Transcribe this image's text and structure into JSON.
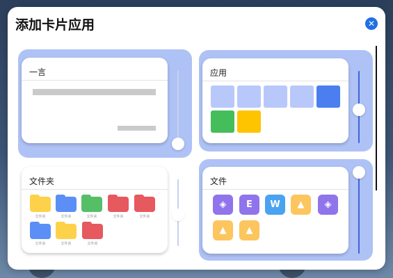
{
  "dialog": {
    "title": "添加卡片应用"
  },
  "cards": [
    {
      "title": "一言",
      "enabled": false
    },
    {
      "title": "应用",
      "enabled": true
    },
    {
      "title": "文件夹",
      "enabled": false
    },
    {
      "title": "文件",
      "enabled": true
    }
  ],
  "apps_tiles": [
    "#b9c8fb",
    "#b9c8fb",
    "#b9c8fb",
    "#b9c8fb",
    "#4b7fef",
    "#45bd5b",
    "#fec400"
  ],
  "folders": [
    {
      "label": "文件夹",
      "color": "#fdd24a"
    },
    {
      "label": "文件夹",
      "color": "#5b8ff5"
    },
    {
      "label": "文件夹",
      "color": "#55bf68"
    },
    {
      "label": "文件夹",
      "color": "#e6595f"
    },
    {
      "label": "文件夹",
      "color": "#e6595f"
    },
    {
      "label": "文件夹",
      "color": "#5b8ff5"
    },
    {
      "label": "文件夹",
      "color": "#fdd24a"
    },
    {
      "label": "文件夹",
      "color": "#e6595f"
    }
  ],
  "files": [
    {
      "icon": "cube-icon",
      "glyph": "◈",
      "color": "#8f74ec"
    },
    {
      "icon": "e-document-icon",
      "glyph": "E",
      "color": "#8f74ec"
    },
    {
      "icon": "w-document-icon",
      "glyph": "W",
      "color": "#4aa3f0"
    },
    {
      "icon": "image-file-icon",
      "glyph": "▲",
      "color": "#fcc55e"
    },
    {
      "icon": "cube-icon",
      "glyph": "◈",
      "color": "#8f74ec"
    },
    {
      "icon": "image-file-icon",
      "glyph": "▲",
      "color": "#fcc55e"
    },
    {
      "icon": "image-file-icon",
      "glyph": "▲",
      "color": "#fcc55e"
    }
  ],
  "colors": {
    "accent": "#1f6fe5",
    "selected_slot": "#afc2f6",
    "slider_on": "#3f63d8",
    "slider_off": "#c7d1ee"
  }
}
